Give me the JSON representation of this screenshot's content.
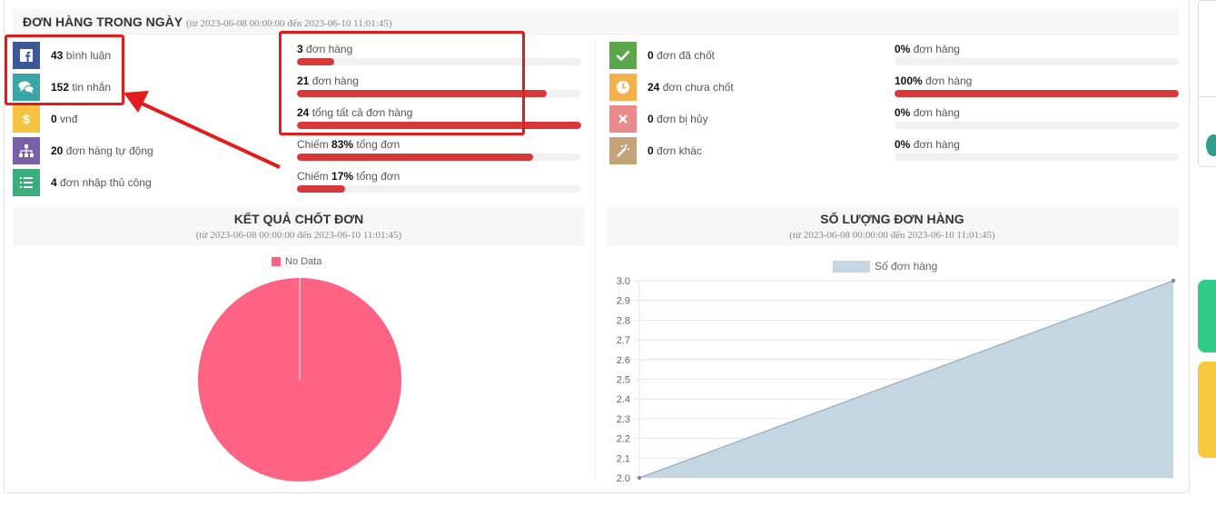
{
  "header": {
    "title": "ĐƠN HÀNG TRONG NGÀY",
    "range": "(từ 2023-06-08 00:00:00 đến 2023-06-10 11:01:45)"
  },
  "left_stats": [
    {
      "value": "43",
      "label": "bình luận",
      "icon": "facebook-icon",
      "color": "#3b5998"
    },
    {
      "value": "152",
      "label": "tin nhắn",
      "icon": "chat-icon",
      "color": "#3aa6a8"
    },
    {
      "value": "0",
      "label": "vnđ",
      "icon": "dollar-icon",
      "color": "#f5c242"
    },
    {
      "value": "20",
      "label": "đơn hàng tự động",
      "icon": "sitemap-icon",
      "color": "#7a5fa9"
    },
    {
      "value": "4",
      "label": "đơn nhập thủ công",
      "icon": "list-icon",
      "color": "#3bae7e"
    }
  ],
  "mid_bars": [
    {
      "prefix": "",
      "value": "3",
      "label": "đơn hàng",
      "pct": 13
    },
    {
      "prefix": "",
      "value": "21",
      "label": "đơn hàng",
      "pct": 88
    },
    {
      "prefix": "",
      "value": "24",
      "label": "tổng tất cả đơn hàng",
      "pct": 100
    },
    {
      "prefix": "Chiếm",
      "value": "83%",
      "label": "tổng đơn",
      "pct": 83
    },
    {
      "prefix": "Chiếm",
      "value": "17%",
      "label": "tổng đơn",
      "pct": 17
    }
  ],
  "right_stats": [
    {
      "value": "0",
      "label": "đơn đã chốt",
      "icon": "check-icon",
      "color": "#5aa64a"
    },
    {
      "value": "24",
      "label": "đơn chưa chốt",
      "icon": "clock-icon",
      "color": "#f5b04a"
    },
    {
      "value": "0",
      "label": "đơn bị hủy",
      "icon": "close-icon",
      "color": "#e98a8a"
    },
    {
      "value": "0",
      "label": "đơn khác",
      "icon": "magic-icon",
      "color": "#c4a27a"
    }
  ],
  "right_bars": [
    {
      "value": "0%",
      "label": "đơn hàng",
      "pct": 0
    },
    {
      "value": "100%",
      "label": "đơn hàng",
      "pct": 100
    },
    {
      "value": "0%",
      "label": "đơn hàng",
      "pct": 0
    },
    {
      "value": "0%",
      "label": "đơn hàng",
      "pct": 0
    }
  ],
  "pie_box": {
    "title": "KẾT QUẢ CHỐT ĐƠN",
    "range": "(từ 2023-06-08 00:00:00 đến 2023-06-10 11:01:45)",
    "legend": "No Data",
    "color": "#ff6384"
  },
  "line_box": {
    "title": "SỐ LƯỢNG ĐƠN HÀNG",
    "range": "(từ 2023-06-08 00:00:00 đến 2023-06-10 11:01:45)"
  },
  "chart_data": [
    {
      "type": "pie",
      "labels": [
        "No Data"
      ],
      "values": [
        1
      ],
      "colors": [
        "#ff6384"
      ],
      "legend": "top"
    },
    {
      "type": "area",
      "series": [
        {
          "name": "Số đơn hàng",
          "values": [
            2.0,
            3.0
          ]
        }
      ],
      "x": [
        0,
        1
      ],
      "ylim": [
        2.0,
        3.0
      ],
      "yticks": [
        "3.0",
        "2.9",
        "2.8",
        "2.7",
        "2.6",
        "2.5",
        "2.4",
        "2.3",
        "2.2",
        "2.1",
        "2.0"
      ],
      "grid": true,
      "legend": "top",
      "fill": "#c3d6e1",
      "stroke": "#95adbe"
    }
  ]
}
